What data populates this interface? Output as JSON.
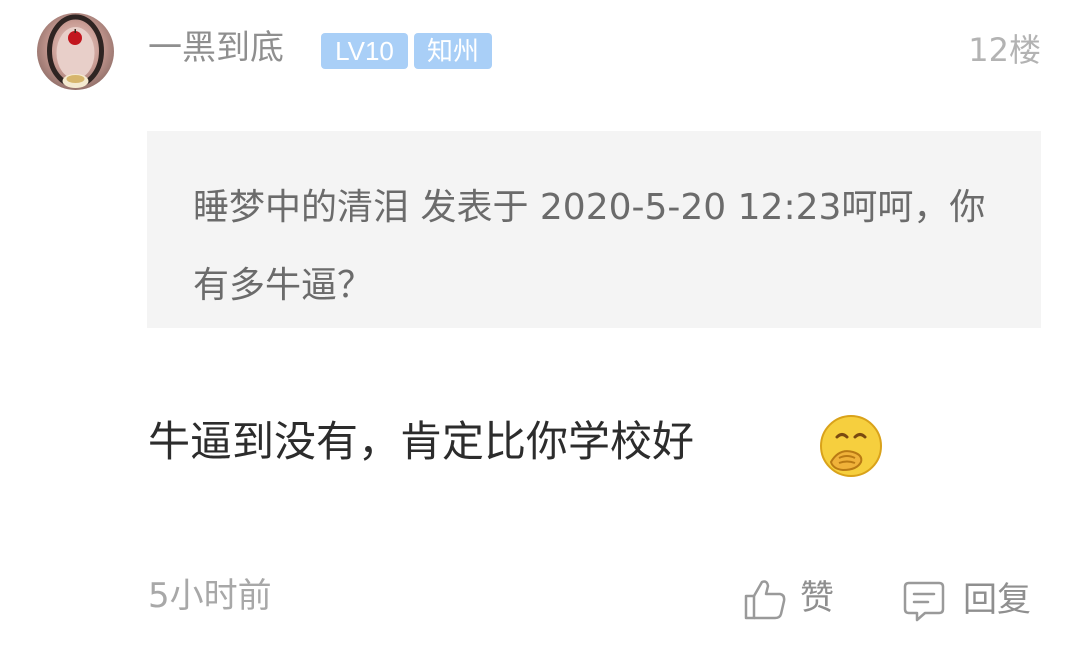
{
  "comment": {
    "username": "一黑到底",
    "level_badge": "LV10",
    "location_badge": "知州",
    "floor": "12楼",
    "quote": "睡梦中的清泪 发表于 2020-5-20 12:23呵呵，你有多牛逼？",
    "body": "牛逼到没有，肯定比你学校好",
    "emoji": "hand-over-mouth-face-icon",
    "time": "5小时前",
    "like_label": "赞",
    "reply_label": "回复"
  },
  "colors": {
    "badge_background": "#a9cff7",
    "quote_background": "#f4f4f4",
    "secondary_text": "#8f8f8f",
    "body_text": "#2c2c2c"
  }
}
